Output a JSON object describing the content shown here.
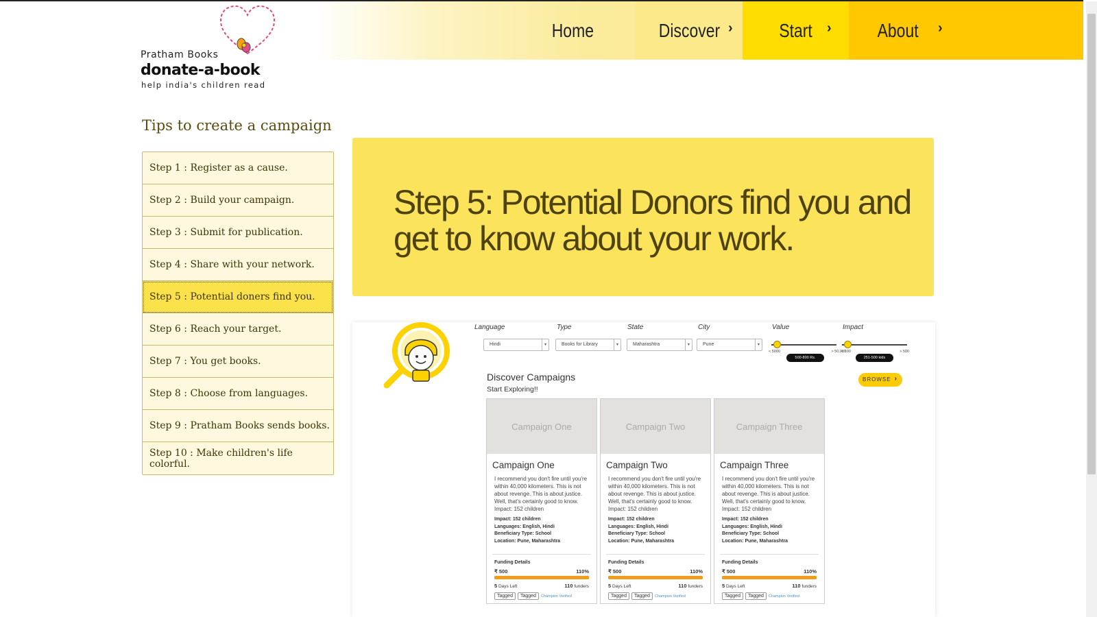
{
  "header": {
    "brand_line1": "Pratham Books",
    "brand_line2": "donate-a-book",
    "brand_tagline": "help india's children read",
    "nav": {
      "home": "Home",
      "discover": "Discover",
      "start": "Start",
      "about": "About"
    },
    "nav_colors": {
      "discover": "#fbe98a",
      "start": "#ffdd00",
      "about": "#ffc800"
    }
  },
  "sidebar": {
    "title": "Tips to create a campaign",
    "active_index": 4,
    "steps": [
      {
        "label": "Step 1 : Register as a cause."
      },
      {
        "label": "Step 2 : Build your campaign."
      },
      {
        "label": "Step 3 : Submit for publication."
      },
      {
        "label": "Step 4 : Share with your network."
      },
      {
        "label": "Step 5 : Potential doners find you."
      },
      {
        "label": "Step 6 : Reach your target."
      },
      {
        "label": "Step 7 : You get books."
      },
      {
        "label": "Step 8 : Choose from languages."
      },
      {
        "label": "Step 9 : Pratham Books sends books."
      },
      {
        "label": "Step 10 : Make children's life colorful."
      }
    ]
  },
  "hero": {
    "title": "Step 5: Potential Donors find you and get to know about your work.",
    "accent": "#fbe35b"
  },
  "preview": {
    "filters": {
      "language": {
        "label": "Language",
        "value": "Hindi"
      },
      "type": {
        "label": "Type",
        "value": "Books for Library"
      },
      "state": {
        "label": "State",
        "value": "Maharashtra"
      },
      "city": {
        "label": "City",
        "value": "Pune"
      },
      "value": {
        "label": "Value",
        "min": "< 5000",
        "max": "> 50,000",
        "tip": "500-800 Rs."
      },
      "impact": {
        "label": "Impact",
        "min": "< 100",
        "max": "> 500",
        "tip": "251-500 kids"
      }
    },
    "discover_title": "Discover Campaigns",
    "discover_sub": "Start Exploring!!",
    "browse_label": "BROWSE",
    "cards": [
      {
        "thumb": "Campaign One",
        "title": "Campaign One",
        "desc": "I recommend you don't fire until you're within 40,000 kilometers. This is not about revenge. This is about justice. Well, that's certainly good to know. Impact: 152 children",
        "impact": "Impact: 152 children",
        "languages": "Languages: English, Hindi",
        "beneficiary": "Beneficiary Type: School",
        "location": "Location: Pune, Maharashtra",
        "funding_label": "Funding Details",
        "amount": "₹ 500",
        "percent": "110%",
        "progress": 1.0,
        "days_num": "5",
        "days_text": "Days Left",
        "funders_num": "110",
        "funders_text": "funders",
        "tag1": "Tagged",
        "tag2": "Tagged",
        "verified": "Champion Verified"
      },
      {
        "thumb": "Campaign Two",
        "title": "Campaign Two",
        "desc": "I recommend you don't fire until you're within 40,000 kilometers. This is not about revenge. This is about justice. Well, that's certainly good to know. Impact: 152 children",
        "impact": "Impact: 152 children",
        "languages": "Languages: English, Hindi",
        "beneficiary": "Beneficiary Type: School",
        "location": "Location: Pune, Maharashtra",
        "funding_label": "Funding Details",
        "amount": "₹ 500",
        "percent": "110%",
        "progress": 1.0,
        "days_num": "5",
        "days_text": "Days Left",
        "funders_num": "110",
        "funders_text": "funders",
        "tag1": "Tagged",
        "tag2": "Tagged",
        "verified": "Champion Verified"
      },
      {
        "thumb": "Campaign Three",
        "title": "Campaign Three",
        "desc": "I recommend you don't fire until you're within 40,000 kilometers. This is not about revenge. This is about justice. Well, that's certainly good to know. Impact: 152 children",
        "impact": "Impact: 152 children",
        "languages": "Languages: English, Hindi",
        "beneficiary": "Beneficiary Type: School",
        "location": "Location: Pune, Maharashtra",
        "funding_label": "Funding Details",
        "amount": "₹ 500",
        "percent": "110%",
        "progress": 1.0,
        "days_num": "5",
        "days_text": "Days Left",
        "funders_num": "110",
        "funders_text": "funders",
        "tag1": "Tagged",
        "tag2": "Tagged",
        "verified": "Champion Verified"
      }
    ]
  }
}
